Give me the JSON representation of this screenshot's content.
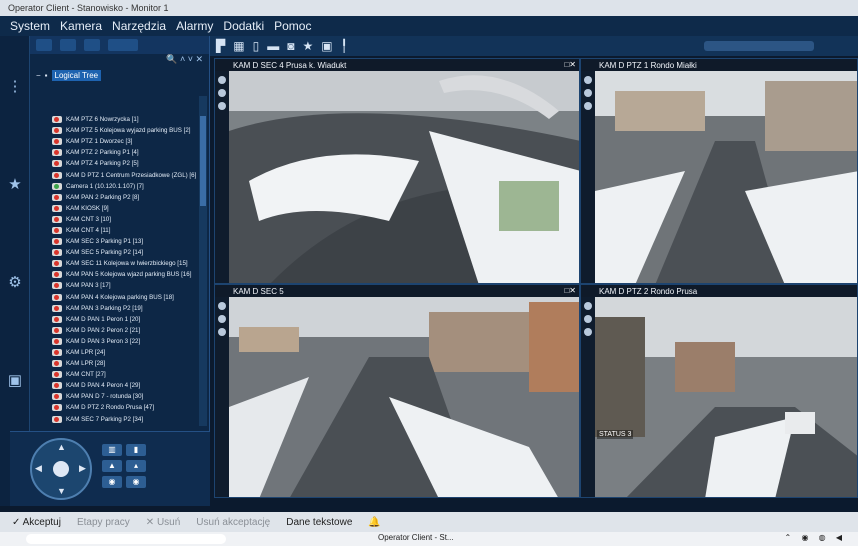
{
  "window": {
    "title": "Operator Client - Stanowisko - Monitor 1"
  },
  "menu": [
    "System",
    "Kamera",
    "Narzędzia",
    "Alarmy",
    "Dodatki",
    "Pomoc"
  ],
  "tree": {
    "root_label": "Logical Tree",
    "search_glyphs": "🔍 ˄ ˅ ✕",
    "items": [
      {
        "label": "KAM PTZ 6 Nowrzycka [1]",
        "state": "red"
      },
      {
        "label": "KAM PTZ 5 Kolejowa wyjazd parking BUS [2]",
        "state": "red"
      },
      {
        "label": "KAM PTZ 1 Dworzec [3]",
        "state": "red"
      },
      {
        "label": "KAM PTZ 2 Parking P1 [4]",
        "state": "red"
      },
      {
        "label": "KAM PTZ 4 Parking P2 [5]",
        "state": "red"
      },
      {
        "label": "KAM D PTZ 1 Centrum Przesiadkowe (ZGL) [6]",
        "state": "red"
      },
      {
        "label": "Camera 1 (10.120.1.107) [7]",
        "state": "green"
      },
      {
        "label": "KAM PAN 2 Parking P2 [8]",
        "state": "red"
      },
      {
        "label": "KAM KIOSK [9]",
        "state": "red"
      },
      {
        "label": "KAM CNT 3 [10]",
        "state": "red"
      },
      {
        "label": "KAM CNT 4 [11]",
        "state": "red"
      },
      {
        "label": "KAM SEC 3 Parking P1 [13]",
        "state": "red"
      },
      {
        "label": "KAM SEC 5 Parking P2 [14]",
        "state": "red"
      },
      {
        "label": "KAM SEC 11 Kolejowa w Iwierzbickiego [15]",
        "state": "red"
      },
      {
        "label": "KAM PAN 5 Kolejowa wjazd parking BUS [16]",
        "state": "red"
      },
      {
        "label": "KAM PAN 3 [17]",
        "state": "red"
      },
      {
        "label": "KAM PAN 4 Kolejowa parking BUS [18]",
        "state": "red"
      },
      {
        "label": "KAM PAN 3 Parking P2 [19]",
        "state": "red"
      },
      {
        "label": "KAM D PAN 1 Peron 1 [20]",
        "state": "red"
      },
      {
        "label": "KAM D PAN 2 Peron 2 [21]",
        "state": "red"
      },
      {
        "label": "KAM D PAN 3 Peron 3 [22]",
        "state": "red"
      },
      {
        "label": "KAM LPR [24]",
        "state": "red"
      },
      {
        "label": "KAM LPR [28]",
        "state": "red"
      },
      {
        "label": "KAM CNT [27]",
        "state": "red"
      },
      {
        "label": "KAM D PAN 4 Peron 4 [29]",
        "state": "red"
      },
      {
        "label": "KAM PAN D 7 - rotunda [30]",
        "state": "red"
      },
      {
        "label": "KAM D PTZ 2 Rondo Prusa [47]",
        "state": "red"
      },
      {
        "label": "KAM SEC 7 Parking P2 [34]",
        "state": "red"
      }
    ]
  },
  "tiles": [
    {
      "title": "KAM D SEC 4 Prusa k. Wiadukt",
      "status": ""
    },
    {
      "title": "KAM D PTZ 1 Rondo Miałki",
      "status": ""
    },
    {
      "title": "KAM D SEC 5",
      "status": ""
    },
    {
      "title": "KAM D PTZ 2 Rondo Prusa",
      "status": "STATUS 3"
    }
  ],
  "actions": [
    {
      "label": "✓ Akceptuj",
      "enabled": true
    },
    {
      "label": "Etapy pracy",
      "enabled": false
    },
    {
      "label": "✕ Usuń",
      "enabled": false
    },
    {
      "label": "Usuń akceptację",
      "enabled": false
    },
    {
      "label": "Dane tekstowe",
      "enabled": true
    }
  ],
  "taskbar": {
    "active_app": "Operator Client - St..."
  },
  "colors": {
    "panel_bg": "#0d2746",
    "accent": "#1e63b0",
    "alarm_red": "#d9342b"
  }
}
